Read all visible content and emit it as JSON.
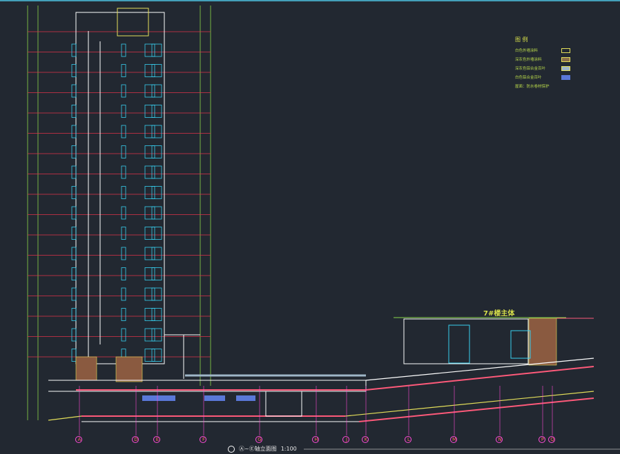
{
  "legend": {
    "title": "图 例",
    "items": [
      {
        "label": "白色外墙涂料",
        "color": "#222831"
      },
      {
        "label": "深灰色外墙涂料",
        "color": "#8a6e4a"
      },
      {
        "label": "深灰色铝合金百叶",
        "color": "#9fb6c8"
      },
      {
        "label": "白色铝合金百叶",
        "color": "#5a78d8"
      },
      {
        "label": "屋面：防水卷材保护",
        "color": ""
      }
    ]
  },
  "building_label": "7#楼主体",
  "drawing_title": "Ⓐ~Ⓔ轴立面图",
  "drawing_scale": "1:100",
  "axis_labels": [
    "A",
    "D",
    "E",
    "F",
    "G",
    "H",
    "J",
    "K",
    "L",
    "M",
    "N",
    "P",
    "Q",
    "R"
  ],
  "colors": {
    "background": "#222831",
    "level_line": "#e0324a",
    "dimension": "#8bd84a",
    "wall": "#ffffff",
    "window": "#38d0f0",
    "accent_brown": "#8a5a40",
    "legend_text": "#b8d84a"
  }
}
